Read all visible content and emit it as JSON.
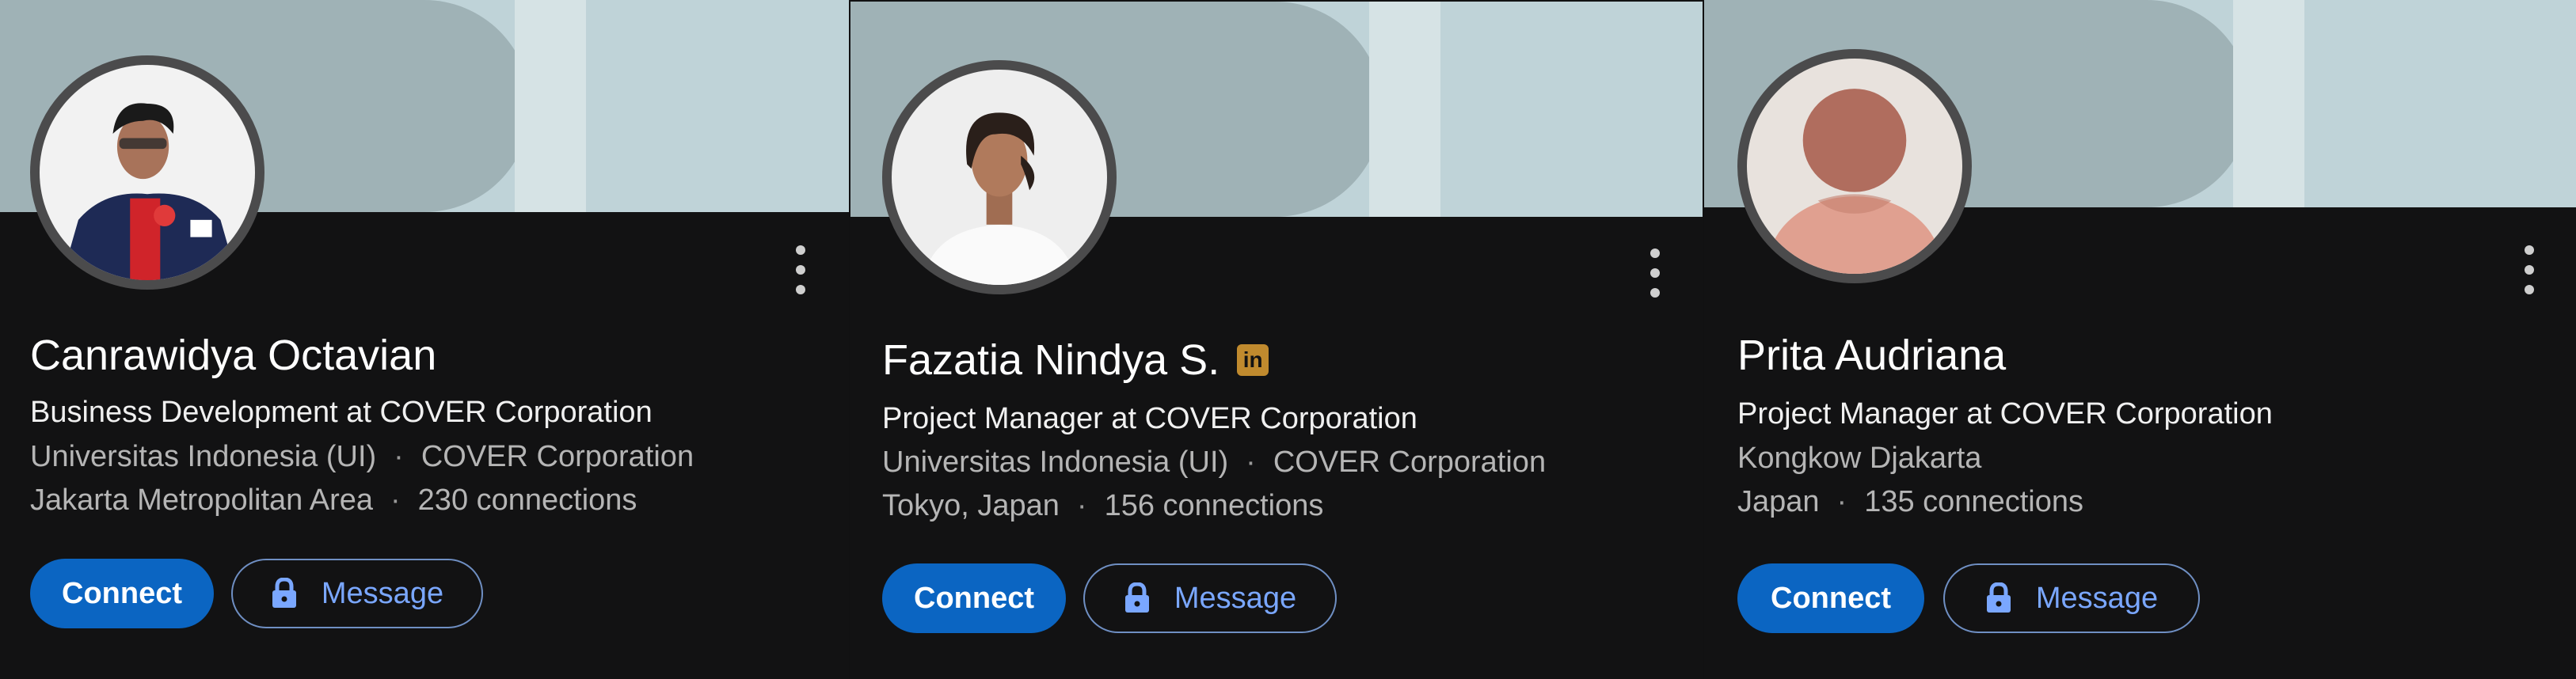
{
  "profiles": [
    {
      "name": "Canrawidya Octavian",
      "headline": "Business Development at COVER Corporation",
      "school": "Universitas Indonesia (UI)",
      "company": "COVER Corporation",
      "location": "Jakarta Metropolitan Area",
      "connections": "230 connections",
      "connect_label": "Connect",
      "message_label": "Message",
      "has_badge": false,
      "avatar": "photo-man-jacket"
    },
    {
      "name": "Fazatia Nindya S.",
      "headline": "Project Manager at COVER Corporation",
      "school": "Universitas Indonesia (UI)",
      "company": "COVER Corporation",
      "location": "Tokyo, Japan",
      "connections": "156 connections",
      "connect_label": "Connect",
      "message_label": "Message",
      "has_badge": true,
      "badge_text": "in",
      "avatar": "photo-woman-white"
    },
    {
      "name": "Prita Audriana",
      "headline": "Project Manager at COVER Corporation",
      "school": "Kongkow Djakarta",
      "company": "",
      "location": "Japan",
      "connections": "135 connections",
      "connect_label": "Connect",
      "message_label": "Message",
      "has_badge": false,
      "avatar": "placeholder-avatar"
    }
  ],
  "colors": {
    "background": "#121213",
    "banner": "#bfd3d8",
    "connect_button": "#0b65c2",
    "message_text": "#7aa7ff",
    "badge": "#c08a2e"
  },
  "icons": [
    "more-vertical-icon",
    "lock-icon",
    "linkedin-premium-icon"
  ]
}
